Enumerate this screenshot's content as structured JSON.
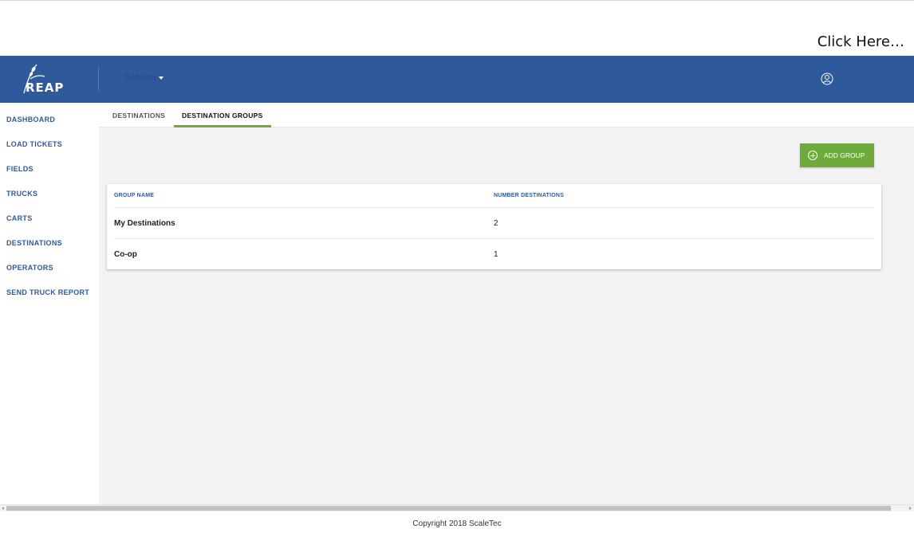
{
  "annotation": {
    "text": "Click Here…"
  },
  "header": {
    "logo_text": "REAP",
    "season_label": "Season",
    "user_icon": "user-circle-icon",
    "bar_color": "#2e5a9c"
  },
  "sidebar": {
    "items": [
      {
        "label": "DASHBOARD"
      },
      {
        "label": "LOAD TICKETS"
      },
      {
        "label": "FIELDS"
      },
      {
        "label": "TRUCKS"
      },
      {
        "label": "CARTS"
      },
      {
        "label": "DESTINATIONS"
      },
      {
        "label": "OPERATORS"
      },
      {
        "label": "SEND TRUCK REPORT"
      }
    ]
  },
  "tabs": [
    {
      "label": "DESTINATIONS",
      "active": false
    },
    {
      "label": "DESTINATION GROUPS",
      "active": true
    }
  ],
  "actions": {
    "add_group_label": "ADD GROUP",
    "add_group_icon": "plus-circle-icon",
    "button_color": "#6fab3c"
  },
  "table": {
    "columns": [
      "GROUP NAME",
      "NUMBER DESTINATIONS"
    ],
    "rows": [
      {
        "name": "My Destinations",
        "count": "2"
      },
      {
        "name": "Co-op",
        "count": "1"
      }
    ]
  },
  "footer": {
    "copyright": "Copyright 2018 ScaleTec"
  },
  "colors": {
    "arrow": "#c00000",
    "accent": "#6fab3c"
  }
}
